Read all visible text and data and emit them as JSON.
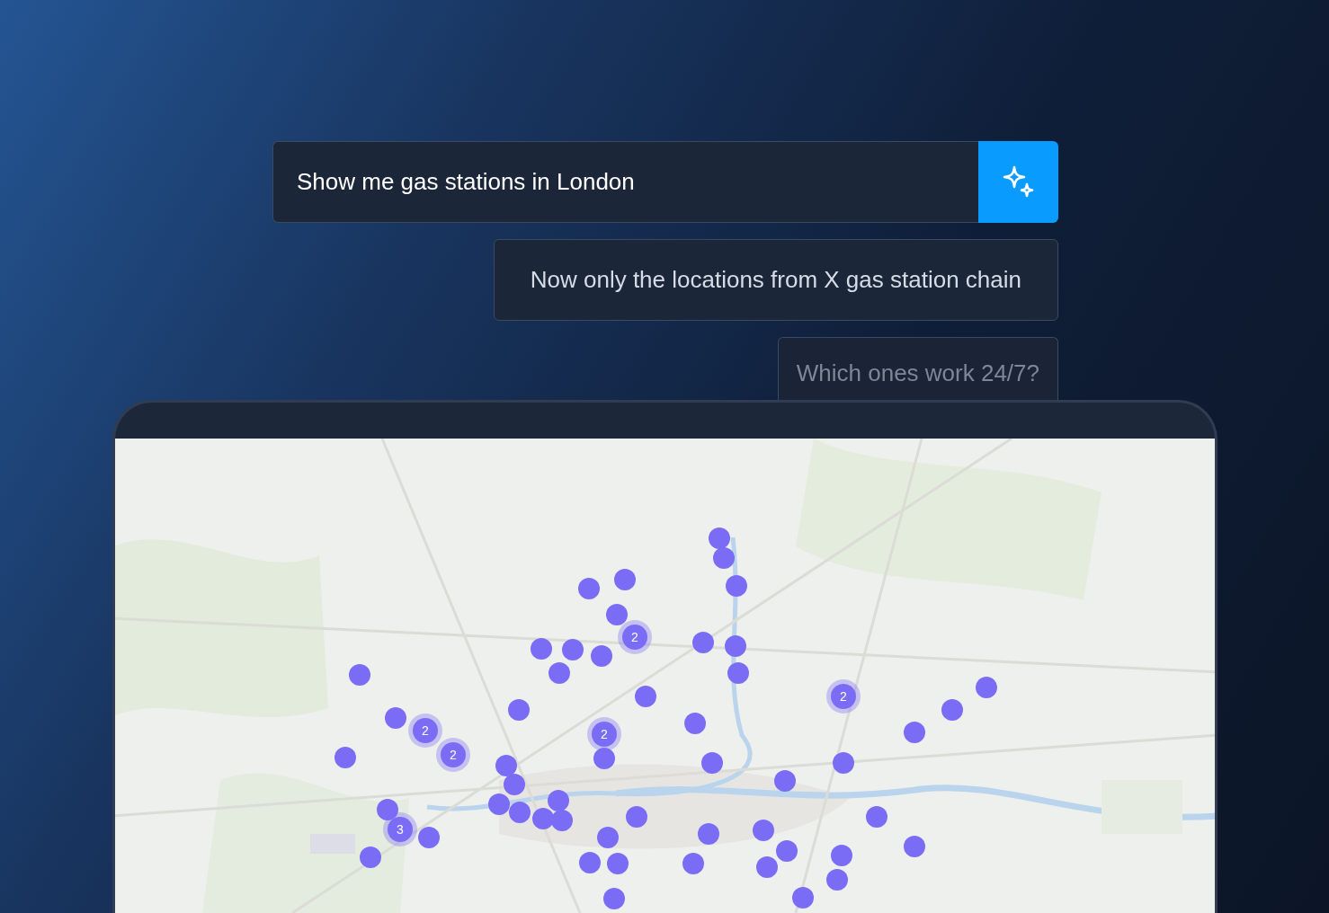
{
  "prompts": [
    {
      "kind": "input",
      "text": "Show me gas stations in London"
    },
    {
      "kind": "suggestion",
      "text": "Now only the locations from X gas station chain"
    },
    {
      "kind": "faded",
      "text": "Which ones work 24/7?"
    }
  ],
  "map": {
    "kind": "picture",
    "clusters": [
      {
        "count": "2"
      },
      {
        "count": "2"
      },
      {
        "count": "2"
      },
      {
        "count": "2"
      },
      {
        "count": "2"
      },
      {
        "count": "3"
      }
    ]
  }
}
